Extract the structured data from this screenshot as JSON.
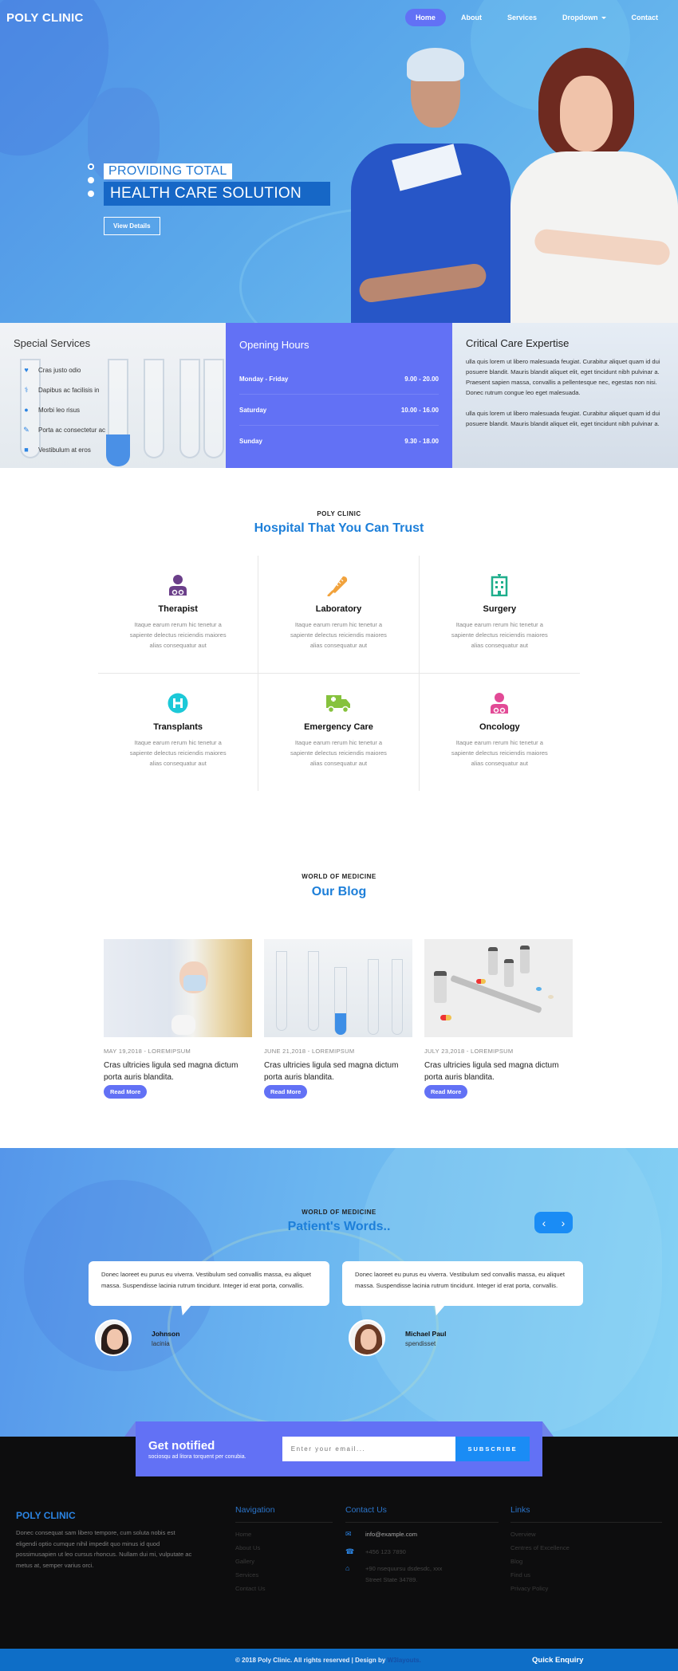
{
  "header": {
    "logo": "POLY CLINIC",
    "nav": [
      {
        "label": "Home",
        "active": true
      },
      {
        "label": "About",
        "active": false
      },
      {
        "label": "Services",
        "active": false
      },
      {
        "label": "Dropdown",
        "active": false,
        "has_caret": true
      },
      {
        "label": "Contact",
        "active": false
      }
    ]
  },
  "hero": {
    "line1": "PROVIDING TOTAL",
    "line2": "HEALTH CARE SOLUTION",
    "button": "View Details",
    "slide_count": 3,
    "active_slide": 1
  },
  "special_services": {
    "title": "Special Services",
    "items": [
      {
        "icon": "heart-icon",
        "label": "Cras justo odio"
      },
      {
        "icon": "doctor-icon",
        "label": "Dapibus ac facilisis in"
      },
      {
        "icon": "pills-icon",
        "label": "Morbi leo risus"
      },
      {
        "icon": "syringe-icon",
        "label": "Porta ac consectetur ac"
      },
      {
        "icon": "ambulance-icon",
        "label": "Vestibulum at eros"
      }
    ]
  },
  "opening_hours": {
    "title": "Opening Hours",
    "rows": [
      {
        "day": "Monday - Friday",
        "time": "9.00 - 20.00"
      },
      {
        "day": "Saturday",
        "time": "10.00 - 16.00"
      },
      {
        "day": "Sunday",
        "time": "9.30 - 18.00"
      }
    ]
  },
  "critical_care": {
    "title": "Critical Care Expertise",
    "p1": "ulla quis lorem ut libero malesuada feugiat. Curabitur aliquet quam id dui posuere blandit. Mauris blandit aliquet elit, eget tincidunt nibh pulvinar a. Praesent sapien massa, convallis a pellentesque nec, egestas non nisi. Donec rutrum congue leo eget malesuada.",
    "p2": "ulla quis lorem ut libero malesuada feugiat. Curabitur aliquet quam id dui posuere blandit. Mauris blandit aliquet elit, eget tincidunt nibh pulvinar a."
  },
  "services": {
    "subtitle": "POLY CLINIC",
    "title": "Hospital That You Can Trust",
    "items": [
      {
        "icon": "therapist-icon",
        "color": "#6b3f8a",
        "title": "Therapist",
        "text": "Itaque earum rerum hic tenetur a sapiente delectus reiciendis maiores alias consequatur aut"
      },
      {
        "icon": "thermometer-icon",
        "color": "#f1a23c",
        "title": "Laboratory",
        "text": "Itaque earum rerum hic tenetur a sapiente delectus reiciendis maiores alias consequatur aut"
      },
      {
        "icon": "hospital-icon",
        "color": "#1fae8c",
        "title": "Surgery",
        "text": "Itaque earum rerum hic tenetur a sapiente delectus reiciendis maiores alias consequatur aut"
      },
      {
        "icon": "hospital-sign-icon",
        "color": "#1cc9d8",
        "title": "Transplants",
        "text": "Itaque earum rerum hic tenetur a sapiente delectus reiciendis maiores alias consequatur aut"
      },
      {
        "icon": "ambulance-icon",
        "color": "#86c23d",
        "title": "Emergency Care",
        "text": "Itaque earum rerum hic tenetur a sapiente delectus reiciendis maiores alias consequatur aut"
      },
      {
        "icon": "doctor-icon",
        "color": "#e24a96",
        "title": "Oncology",
        "text": "Itaque earum rerum hic tenetur a sapiente delectus reiciendis maiores alias consequatur aut"
      }
    ]
  },
  "blog": {
    "subtitle": "WORLD OF MEDICINE",
    "title": "Our Blog",
    "posts": [
      {
        "meta": "MAY 19,2018 - LOREMIPSUM",
        "title": "Cras ultricies ligula sed magna dictum porta auris blandita.",
        "button": "Read More"
      },
      {
        "meta": "JUNE 21,2018 - LOREMIPSUM",
        "title": "Cras ultricies ligula sed magna dictum porta auris blandita.",
        "button": "Read More"
      },
      {
        "meta": "JULY 23,2018 - LOREMIPSUM",
        "title": "Cras ultricies ligula sed magna dictum porta auris blandita.",
        "button": "Read More"
      }
    ]
  },
  "testimonials": {
    "subtitle": "WORLD OF MEDICINE",
    "title": "Patient's Words..",
    "prev": "‹",
    "next": "›",
    "items": [
      {
        "quote": "Donec laoreet eu purus eu viverra. Vestibulum sed convallis massa, eu aliquet massa. Suspendisse lacinia rutrum tincidunt. Integer id erat porta, convallis.",
        "name": "Johnson",
        "role": "lacinia"
      },
      {
        "quote": "Donec laoreet eu purus eu viverra. Vestibulum sed convallis massa, eu aliquet massa. Suspendisse lacinia rutrum tincidunt. Integer id erat porta, convallis.",
        "name": "Michael Paul",
        "role": "spendisset"
      }
    ]
  },
  "newsletter": {
    "title": "Get notified",
    "subtitle": "sociosqu ad litora torquent per conubia.",
    "placeholder": "Enter your email...",
    "button": "SUBSCRIBE"
  },
  "footer": {
    "logo": "POLY CLINIC",
    "about": "Donec consequat sam libero tempore, cum soluta nobis est eligendi optio cumque nihil impedit quo minus id quod possimusapien ut leo cursus rhoncus. Nullam dui mi, vulputate ac metus at, semper varius orci.",
    "navigation": {
      "title": "Navigation",
      "links": [
        "Home",
        "About Us",
        "Gallery",
        "Services",
        "Contact Us"
      ]
    },
    "contact": {
      "title": "Contact Us",
      "email": "info@example.com",
      "phone": "+456 123 7890",
      "address": "+90 nsequursu dsdesdc, xxx Street State 34789."
    },
    "links": {
      "title": "Links",
      "items": [
        "Overview",
        "Centres of Excellence",
        "Blog",
        "Find us",
        "Privacy Policy"
      ]
    },
    "copyright": "© 2018 Poly Clinic. All rights reserved | Design by",
    "designer": "W3layouts.",
    "quick_enquiry": "Quick Enquiry"
  },
  "colors": {
    "primary": "#6271f5",
    "accent": "#1d7fd9",
    "subscribe": "#1a8cf5",
    "footer_bar": "#0e6ec7"
  }
}
